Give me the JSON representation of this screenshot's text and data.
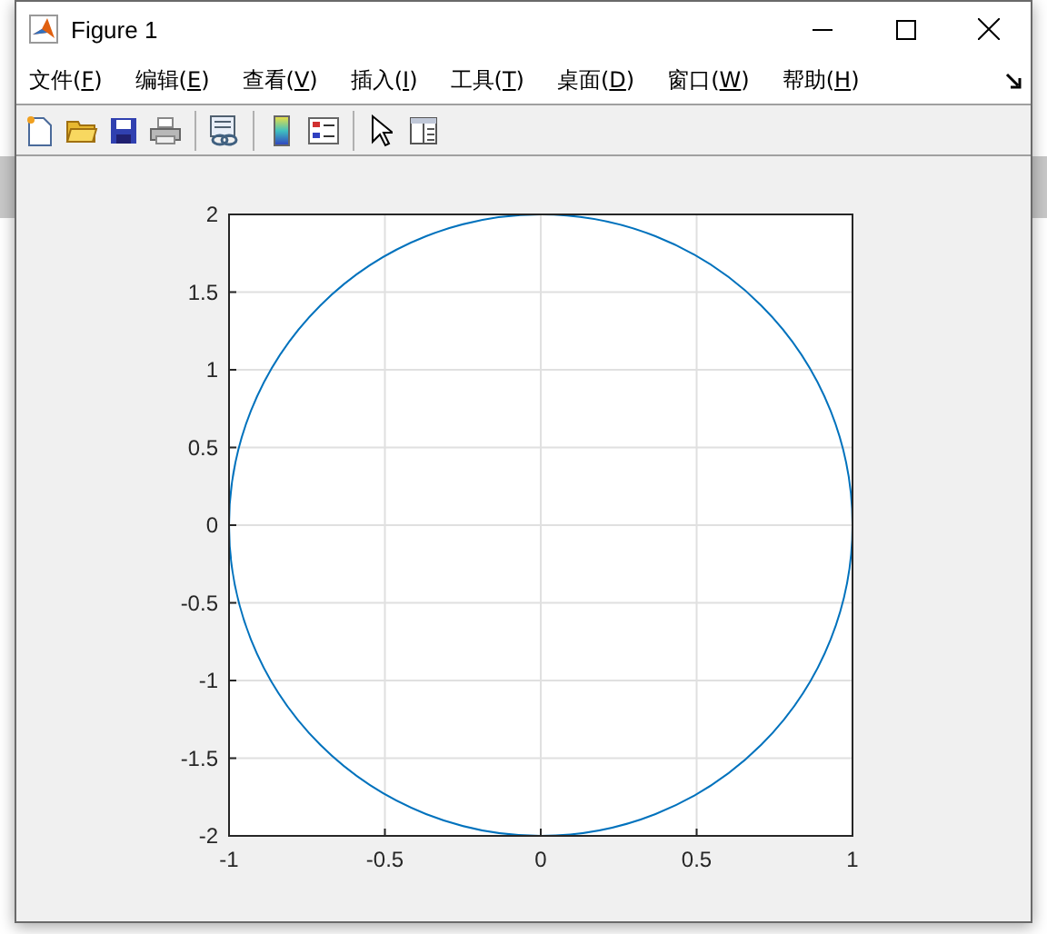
{
  "window": {
    "title": "Figure 1"
  },
  "menu": [
    {
      "before": "文件(",
      "key": "F",
      "after": ")"
    },
    {
      "before": "编辑(",
      "key": "E",
      "after": ")"
    },
    {
      "before": "查看(",
      "key": "V",
      "after": ")"
    },
    {
      "before": "插入(",
      "key": "I",
      "after": ")"
    },
    {
      "before": "工具(",
      "key": "T",
      "after": ")"
    },
    {
      "before": "桌面(",
      "key": "D",
      "after": ")"
    },
    {
      "before": "窗口(",
      "key": "W",
      "after": ")"
    },
    {
      "before": "帮助(",
      "key": "H",
      "after": ")"
    }
  ],
  "toolbar": [
    {
      "kind": "new"
    },
    {
      "kind": "open"
    },
    {
      "kind": "save"
    },
    {
      "kind": "print"
    },
    {
      "kind": "sep"
    },
    {
      "kind": "link"
    },
    {
      "kind": "sep"
    },
    {
      "kind": "colorbar"
    },
    {
      "kind": "legend"
    },
    {
      "kind": "sep"
    },
    {
      "kind": "pointer"
    },
    {
      "kind": "inspector"
    }
  ],
  "chart_data": {
    "type": "line",
    "grid": true,
    "xlim": [
      -1,
      1
    ],
    "ylim": [
      -2,
      2
    ],
    "xticks": [
      {
        "value": -1,
        "label": "-1"
      },
      {
        "value": -0.5,
        "label": "-0.5"
      },
      {
        "value": 0,
        "label": "0"
      },
      {
        "value": 0.5,
        "label": "0.5"
      },
      {
        "value": 1,
        "label": "1"
      }
    ],
    "yticks": [
      {
        "value": -2,
        "label": "-2"
      },
      {
        "value": -1.5,
        "label": "-1.5"
      },
      {
        "value": -1,
        "label": "-1"
      },
      {
        "value": -0.5,
        "label": "-0.5"
      },
      {
        "value": 0,
        "label": "0"
      },
      {
        "value": 0.5,
        "label": "0.5"
      },
      {
        "value": 1,
        "label": "1"
      },
      {
        "value": 1.5,
        "label": "1.5"
      },
      {
        "value": 2,
        "label": "2"
      }
    ]
  },
  "curves": [
    {
      "kind": "ellipse"
    }
  ]
}
